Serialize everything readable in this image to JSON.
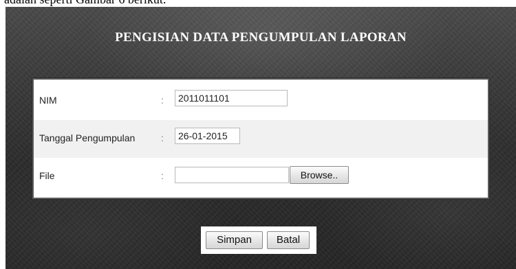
{
  "document": {
    "caption_fragment": "adalah seperti Gambar 6 berikut."
  },
  "form": {
    "title": "PENGISIAN DATA PENGUMPULAN LAPORAN",
    "separator": ":",
    "fields": [
      {
        "label": "NIM",
        "value": "2011011101"
      },
      {
        "label": "Tanggal Pengumpulan",
        "value": "26-01-2015"
      },
      {
        "label": "File",
        "value": ""
      }
    ],
    "browse_label": "Browse..",
    "actions": {
      "save_label": "Simpan",
      "cancel_label": "Batal"
    }
  },
  "colors": {
    "background": "#2c2c2c",
    "form_background": "#ffffff",
    "alt_row": "#f1f1f1",
    "title_text": "#ffffff"
  }
}
